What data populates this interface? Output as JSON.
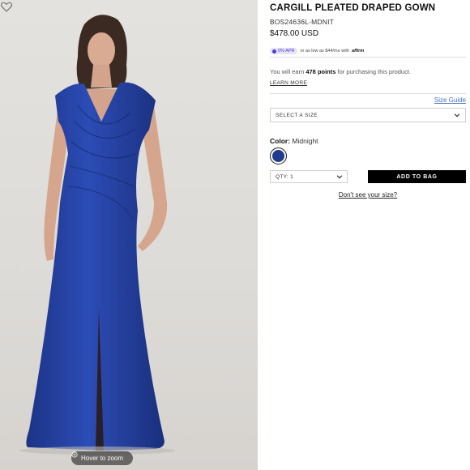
{
  "product": {
    "title": "CARGILL PLEATED DRAPED GOWN",
    "sku": "BOS24636L-MDNIT",
    "price": "$478.00 USD"
  },
  "financing": {
    "apr_badge": "0% APR",
    "text": "or as low as $44/mo with",
    "provider": "affirm",
    "badge_color": "#4a3fd0"
  },
  "rewards": {
    "prefix": "You will earn",
    "points": "478 points",
    "suffix": "for purchasing this product.",
    "learn_more": "LEARN MORE"
  },
  "size": {
    "guide_label": "Size Guide",
    "placeholder": "SELECT A SIZE"
  },
  "color": {
    "label": "Color:",
    "value": "Midnight",
    "swatch_hex": "#1f3b8e"
  },
  "quantity": {
    "label": "QTY: 1"
  },
  "actions": {
    "add_to_bag": "ADD TO BAG",
    "dont_see_size": "Don't see your size?"
  },
  "image": {
    "zoom_label": "Hover to zoom",
    "wishlist_icon": "heart-icon",
    "zoom_icon": "plus-circle-icon"
  },
  "colors": {
    "gown": "#2a48b0",
    "accent_link": "#4a74b8"
  }
}
